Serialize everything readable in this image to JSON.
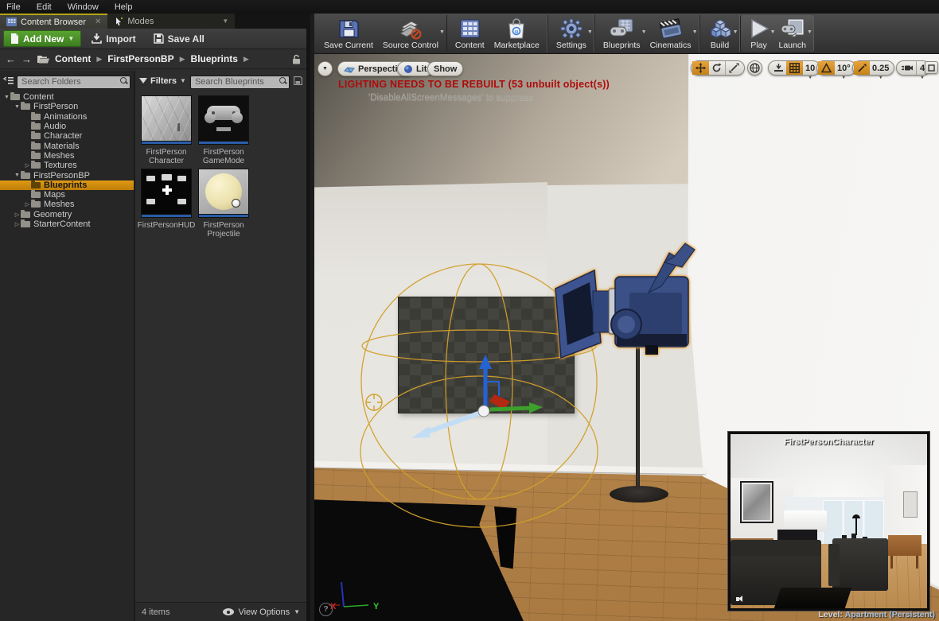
{
  "menu": {
    "items": [
      "File",
      "Edit",
      "Window",
      "Help"
    ]
  },
  "tabs": {
    "content_browser": "Content Browser",
    "modes": "Modes"
  },
  "content_browser": {
    "add_new_label": "Add New",
    "import_label": "Import",
    "save_all_label": "Save All",
    "breadcrumb": [
      "Content",
      "FirstPersonBP",
      "Blueprints"
    ],
    "search_folders_placeholder": "Search Folders",
    "filters_label": "Filters",
    "search_assets_placeholder": "Search Blueprints",
    "tree": [
      {
        "label": "Content",
        "depth": 0,
        "arrow": "expanded",
        "selected": false
      },
      {
        "label": "FirstPerson",
        "depth": 1,
        "arrow": "expanded",
        "selected": false
      },
      {
        "label": "Animations",
        "depth": 2,
        "arrow": "none",
        "selected": false
      },
      {
        "label": "Audio",
        "depth": 2,
        "arrow": "none",
        "selected": false
      },
      {
        "label": "Character",
        "depth": 2,
        "arrow": "none",
        "selected": false
      },
      {
        "label": "Materials",
        "depth": 2,
        "arrow": "none",
        "selected": false
      },
      {
        "label": "Meshes",
        "depth": 2,
        "arrow": "none",
        "selected": false
      },
      {
        "label": "Textures",
        "depth": 2,
        "arrow": "collapsed",
        "selected": false
      },
      {
        "label": "FirstPersonBP",
        "depth": 1,
        "arrow": "expanded",
        "selected": false
      },
      {
        "label": "Blueprints",
        "depth": 2,
        "arrow": "none",
        "selected": true
      },
      {
        "label": "Maps",
        "depth": 2,
        "arrow": "none",
        "selected": false
      },
      {
        "label": "Meshes",
        "depth": 2,
        "arrow": "collapsed",
        "selected": false
      },
      {
        "label": "Geometry",
        "depth": 1,
        "arrow": "collapsed",
        "selected": false
      },
      {
        "label": "StarterContent",
        "depth": 1,
        "arrow": "collapsed",
        "selected": false
      }
    ],
    "assets": [
      {
        "id": "character",
        "lines": [
          "FirstPerson",
          "Character"
        ]
      },
      {
        "id": "gamemode",
        "lines": [
          "FirstPerson",
          "GameMode"
        ]
      },
      {
        "id": "hud",
        "lines": [
          "FirstPersonHUD"
        ]
      },
      {
        "id": "projectile",
        "lines": [
          "FirstPerson",
          "Projectile"
        ]
      }
    ],
    "status_items": "4 items",
    "view_options_label": "View Options"
  },
  "toolbar": {
    "groups": [
      {
        "highlight": false,
        "buttons": [
          {
            "id": "save-current",
            "label": "Save Current",
            "caret": false
          },
          {
            "id": "source-control",
            "label": "Source Control",
            "caret": true
          }
        ]
      },
      {
        "highlight": false,
        "buttons": [
          {
            "id": "content",
            "label": "Content",
            "caret": false
          },
          {
            "id": "marketplace",
            "label": "Marketplace",
            "caret": false
          }
        ]
      },
      {
        "highlight": false,
        "buttons": [
          {
            "id": "settings",
            "label": "Settings",
            "caret": true
          }
        ]
      },
      {
        "highlight": false,
        "buttons": [
          {
            "id": "blueprints",
            "label": "Blueprints",
            "caret": true
          },
          {
            "id": "cinematics",
            "label": "Cinematics",
            "caret": true
          }
        ]
      },
      {
        "highlight": false,
        "buttons": [
          {
            "id": "build",
            "label": "Build",
            "caret": true
          }
        ]
      },
      {
        "highlight": true,
        "buttons": [
          {
            "id": "play",
            "label": "Play",
            "caret": true
          },
          {
            "id": "launch",
            "label": "Launch",
            "caret": true
          }
        ]
      }
    ]
  },
  "viewport": {
    "perspective_label": "Perspective",
    "lit_label": "Lit",
    "show_label": "Show",
    "warning": "LIGHTING NEEDS TO BE REBUILT (53 unbuilt object(s))",
    "warning_sub": "'DisableAllScreenMessages' to suppress",
    "grid_snap_value": "10",
    "rotation_snap_value": "10°",
    "scale_snap_value": "0.25",
    "camera_speed_value": "4",
    "preview_title": "FirstPersonCharacter",
    "level_label": "Level:",
    "level_value": "Apartment (Persistent)",
    "axis_x": "X",
    "axis_y": "Y",
    "help_glyph": "?"
  },
  "colors": {
    "accent_orange": "#d1891f",
    "selection_blue": "#2a5ca8",
    "warning_red": "#ae0b0b",
    "add_new_green": "#4a9128",
    "selection_outline": "#e8a33a"
  }
}
